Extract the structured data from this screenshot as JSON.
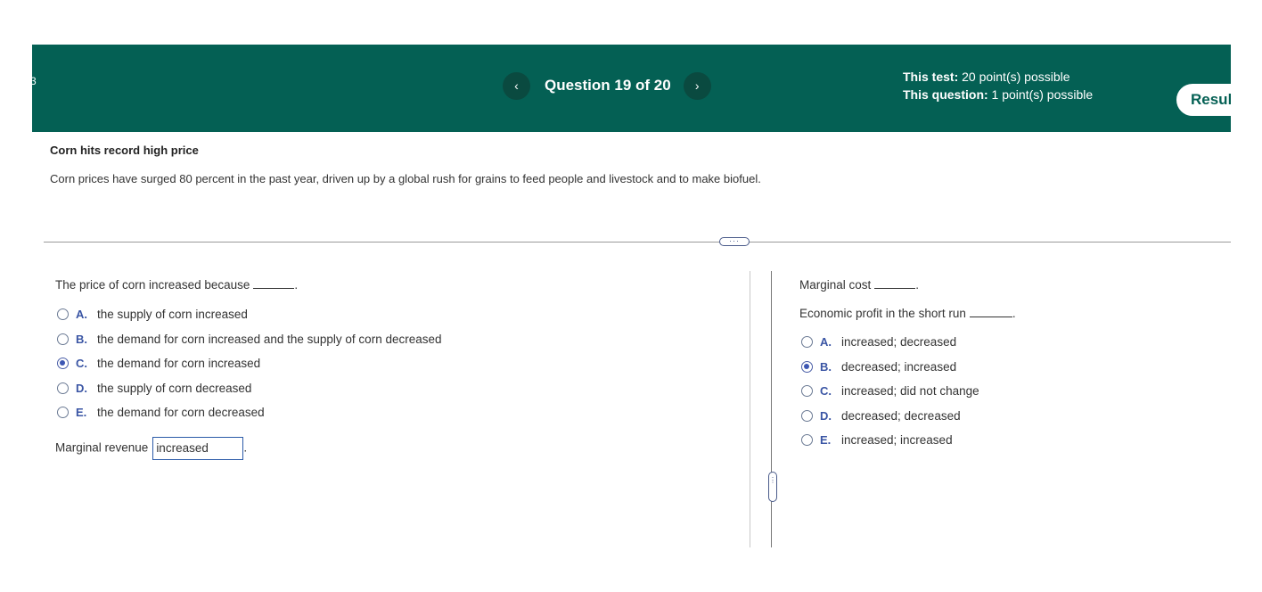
{
  "header": {
    "edge_mark": "3",
    "prev_icon": "chevron-left-icon",
    "next_icon": "chevron-right-icon",
    "prev_glyph": "‹",
    "next_glyph": "›",
    "question_label": "Question 19 of 20",
    "test_label": "This test:",
    "test_value": " 20 point(s) possible",
    "question_points_label": "This question:",
    "question_points_value": " 1 point(s) possible",
    "results_button": "Resul",
    "background_color": "#046054"
  },
  "passage": {
    "title": "Corn hits record high price",
    "text": "Corn prices have surged 80 percent in the past year, driven up by a global rush for grains to feed people and livestock and to make biofuel."
  },
  "splitter": {
    "horizontal_handle": "···",
    "vertical_handle": "⋮"
  },
  "left": {
    "q1_stem": "The price of corn increased because",
    "q1_choices": [
      {
        "letter": "A.",
        "text": "the supply of corn increased",
        "selected": false
      },
      {
        "letter": "B.",
        "text": "the demand for corn increased and the supply of corn decreased",
        "selected": false
      },
      {
        "letter": "C.",
        "text": "the demand for corn increased",
        "selected": true
      },
      {
        "letter": "D.",
        "text": "the supply of corn decreased",
        "selected": false
      },
      {
        "letter": "E.",
        "text": "the demand for corn decreased",
        "selected": false
      }
    ],
    "mr_label": "Marginal revenue",
    "mr_value": "increased",
    "period": "."
  },
  "right": {
    "mc_stem": "Marginal cost",
    "ep_stem": "Economic profit in the short run",
    "choices": [
      {
        "letter": "A.",
        "text": "increased; decreased",
        "selected": false
      },
      {
        "letter": "B.",
        "text": "decreased; increased",
        "selected": true
      },
      {
        "letter": "C.",
        "text": "increased; did not change",
        "selected": false
      },
      {
        "letter": "D.",
        "text": "decreased; decreased",
        "selected": false
      },
      {
        "letter": "E.",
        "text": "increased; increased",
        "selected": false
      }
    ],
    "period": "."
  },
  "colors": {
    "accent": "#3d57b3",
    "header": "#046054"
  }
}
